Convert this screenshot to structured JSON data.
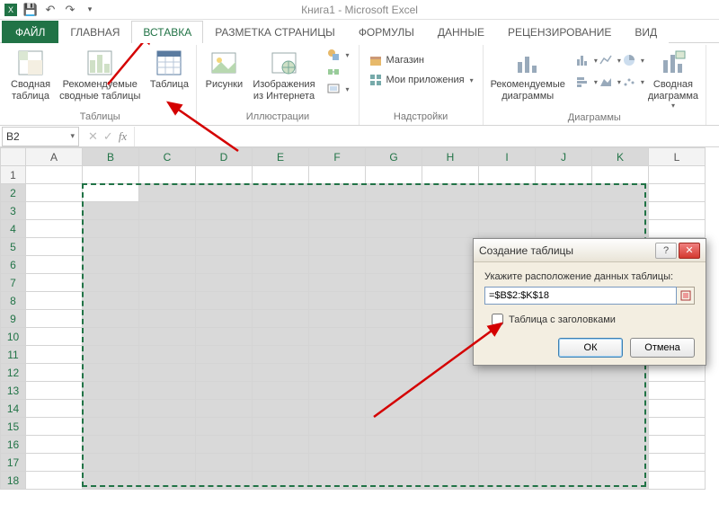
{
  "app": {
    "title_doc": "Книга1",
    "title_app": "Microsoft Excel"
  },
  "qat": {
    "excel_icon": "excel",
    "save": "💾",
    "undo": "↶",
    "redo": "↷"
  },
  "tabs": {
    "file": "ФАЙЛ",
    "items": [
      {
        "id": "home",
        "label": "ГЛАВНАЯ"
      },
      {
        "id": "insert",
        "label": "ВСТАВКА",
        "active": true
      },
      {
        "id": "pagelayout",
        "label": "РАЗМЕТКА СТРАНИЦЫ"
      },
      {
        "id": "formulas",
        "label": "ФОРМУЛЫ"
      },
      {
        "id": "data",
        "label": "ДАННЫЕ"
      },
      {
        "id": "review",
        "label": "РЕЦЕНЗИРОВАНИЕ"
      },
      {
        "id": "view",
        "label": "ВИД"
      }
    ]
  },
  "ribbon": {
    "tables": {
      "group_label": "Таблицы",
      "pivot": "Сводная\nтаблица",
      "recommended_pivot": "Рекомендуемые\nсводные таблицы",
      "table": "Таблица"
    },
    "illustrations": {
      "group_label": "Иллюстрации",
      "pictures": "Рисунки",
      "online_pics": "Изображения\nиз Интернета",
      "shapes": "Фигуры",
      "smartart": "SmartArt",
      "screenshot": "Снимок"
    },
    "addins": {
      "group_label": "Надстройки",
      "store": "Магазин",
      "myapps": "Мои приложения"
    },
    "charts": {
      "group_label": "Диаграммы",
      "recommended": "Рекомендуемые\nдиаграммы",
      "pivotchart": "Сводная\nдиаграмма"
    }
  },
  "namebox": {
    "value": "B2"
  },
  "formula_bar": {
    "value": ""
  },
  "grid": {
    "cols": [
      "A",
      "B",
      "C",
      "D",
      "E",
      "F",
      "G",
      "H",
      "I",
      "J",
      "K",
      "L"
    ],
    "rows": 18,
    "selected_cols_idx": [
      1,
      2,
      3,
      4,
      5,
      6,
      7,
      8,
      9,
      10
    ],
    "selected_rows_idx": [
      2,
      3,
      4,
      5,
      6,
      7,
      8,
      9,
      10,
      11,
      12,
      13,
      14,
      15,
      16,
      17,
      18
    ],
    "active_cell": "B2",
    "selection_range": "B2:K18"
  },
  "dialog": {
    "title": "Создание таблицы",
    "prompt": "Укажите расположение данных таблицы:",
    "range_value": "=$B$2:$K$18",
    "checkbox_label": "Таблица с заголовками",
    "checkbox_checked": false,
    "ok": "ОК",
    "cancel": "Отмена",
    "help_icon": "?",
    "close_icon": "✕"
  },
  "colors": {
    "accent": "#217346",
    "arrow": "#d40000"
  }
}
